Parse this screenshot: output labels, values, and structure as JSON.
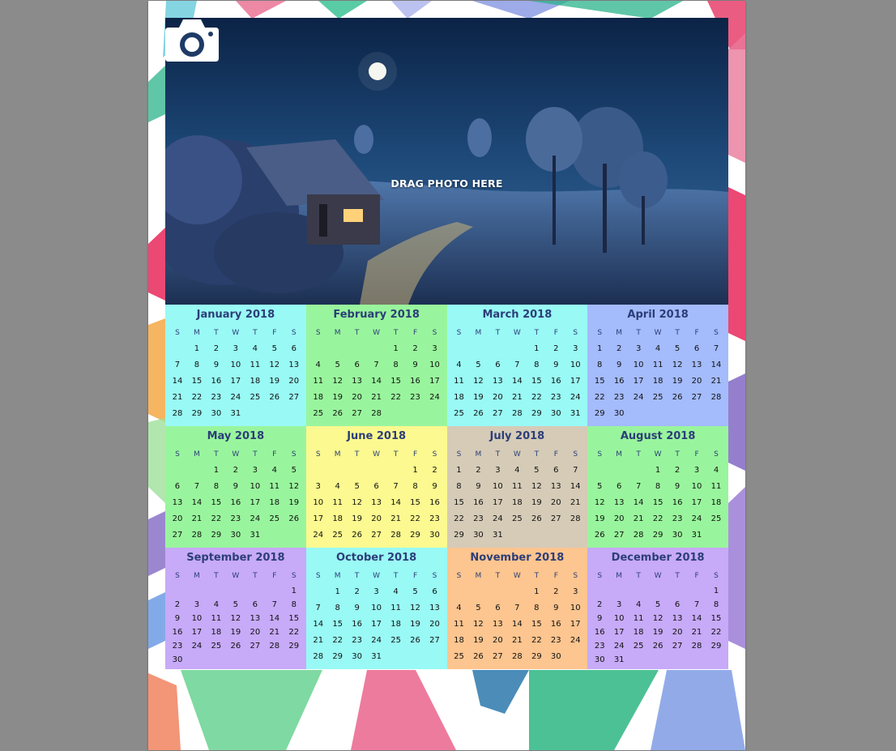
{
  "colors": {
    "workspace": "#8b8b8b",
    "page": "#ffffff",
    "title_text": "#2c3e78",
    "day_text": "#111111"
  },
  "photo": {
    "drop_label": "DRAG PHOTO HERE",
    "icon": "camera-icon"
  },
  "weekday_labels": [
    "S",
    "M",
    "T",
    "W",
    "T",
    "F",
    "S"
  ],
  "months": [
    {
      "title": "January 2018",
      "start": 1,
      "days": 31,
      "color": "#99f9f5"
    },
    {
      "title": "February 2018",
      "start": 4,
      "days": 28,
      "color": "#99f59d"
    },
    {
      "title": "March 2018",
      "start": 4,
      "days": 31,
      "color": "#99f9f5"
    },
    {
      "title": "April 2018",
      "start": 0,
      "days": 30,
      "color": "#a4bbfc"
    },
    {
      "title": "May 2018",
      "start": 2,
      "days": 31,
      "color": "#99f59d"
    },
    {
      "title": "June 2018",
      "start": 5,
      "days": 30,
      "color": "#fbf98f"
    },
    {
      "title": "July 2018",
      "start": 0,
      "days": 31,
      "color": "#d5cbb7"
    },
    {
      "title": "August 2018",
      "start": 3,
      "days": 31,
      "color": "#99f59d"
    },
    {
      "title": "September 2018",
      "start": 6,
      "days": 30,
      "color": "#c7aaf8"
    },
    {
      "title": "October 2018",
      "start": 1,
      "days": 31,
      "color": "#99f9f5"
    },
    {
      "title": "November 2018",
      "start": 4,
      "days": 30,
      "color": "#fdc58f"
    },
    {
      "title": "December 2018",
      "start": 6,
      "days": 31,
      "color": "#c7aaf8"
    }
  ]
}
